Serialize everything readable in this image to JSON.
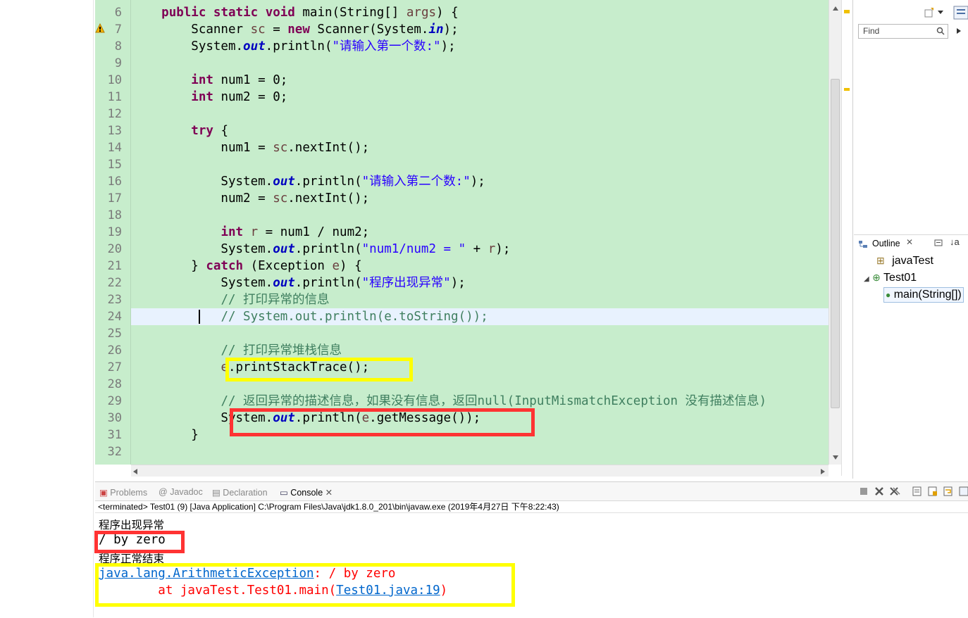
{
  "editor": {
    "lines": [
      {
        "num": "6",
        "segments": [
          {
            "t": "    ",
            "c": ""
          },
          {
            "t": "public",
            "c": "kw"
          },
          {
            "t": " ",
            "c": ""
          },
          {
            "t": "static",
            "c": "kw"
          },
          {
            "t": " ",
            "c": ""
          },
          {
            "t": "void",
            "c": "kw"
          },
          {
            "t": " main(String[] ",
            "c": ""
          },
          {
            "t": "args",
            "c": "var"
          },
          {
            "t": ") {",
            "c": ""
          }
        ]
      },
      {
        "num": "7",
        "segments": [
          {
            "t": "        Scanner ",
            "c": ""
          },
          {
            "t": "sc",
            "c": "var"
          },
          {
            "t": " = ",
            "c": ""
          },
          {
            "t": "new",
            "c": "kw"
          },
          {
            "t": " Scanner(System.",
            "c": ""
          },
          {
            "t": "in",
            "c": "fld"
          },
          {
            "t": ");",
            "c": ""
          }
        ]
      },
      {
        "num": "8",
        "segments": [
          {
            "t": "        System.",
            "c": ""
          },
          {
            "t": "out",
            "c": "fld"
          },
          {
            "t": ".println(",
            "c": ""
          },
          {
            "t": "\"请输入第一个数:\"",
            "c": "str"
          },
          {
            "t": ");",
            "c": ""
          }
        ]
      },
      {
        "num": "9",
        "segments": []
      },
      {
        "num": "10",
        "segments": [
          {
            "t": "        ",
            "c": ""
          },
          {
            "t": "int",
            "c": "kw"
          },
          {
            "t": " num1 = 0;",
            "c": ""
          }
        ]
      },
      {
        "num": "11",
        "segments": [
          {
            "t": "        ",
            "c": ""
          },
          {
            "t": "int",
            "c": "kw"
          },
          {
            "t": " num2 = 0;",
            "c": ""
          }
        ]
      },
      {
        "num": "12",
        "segments": []
      },
      {
        "num": "13",
        "segments": [
          {
            "t": "        ",
            "c": ""
          },
          {
            "t": "try",
            "c": "kw"
          },
          {
            "t": " {",
            "c": ""
          }
        ]
      },
      {
        "num": "14",
        "segments": [
          {
            "t": "            num1 = ",
            "c": ""
          },
          {
            "t": "sc",
            "c": "var"
          },
          {
            "t": ".nextInt();",
            "c": ""
          }
        ]
      },
      {
        "num": "15",
        "segments": []
      },
      {
        "num": "16",
        "segments": [
          {
            "t": "            System.",
            "c": ""
          },
          {
            "t": "out",
            "c": "fld"
          },
          {
            "t": ".println(",
            "c": ""
          },
          {
            "t": "\"请输入第二个数:\"",
            "c": "str"
          },
          {
            "t": ");",
            "c": ""
          }
        ]
      },
      {
        "num": "17",
        "segments": [
          {
            "t": "            num2 = ",
            "c": ""
          },
          {
            "t": "sc",
            "c": "var"
          },
          {
            "t": ".nextInt();",
            "c": ""
          }
        ]
      },
      {
        "num": "18",
        "segments": []
      },
      {
        "num": "19",
        "segments": [
          {
            "t": "            ",
            "c": ""
          },
          {
            "t": "int",
            "c": "kw"
          },
          {
            "t": " ",
            "c": ""
          },
          {
            "t": "r",
            "c": "var"
          },
          {
            "t": " = num1 / num2;",
            "c": ""
          }
        ]
      },
      {
        "num": "20",
        "segments": [
          {
            "t": "            System.",
            "c": ""
          },
          {
            "t": "out",
            "c": "fld"
          },
          {
            "t": ".println(",
            "c": ""
          },
          {
            "t": "\"num1/num2 = \"",
            "c": "str"
          },
          {
            "t": " + ",
            "c": ""
          },
          {
            "t": "r",
            "c": "var"
          },
          {
            "t": ");",
            "c": ""
          }
        ]
      },
      {
        "num": "21",
        "segments": [
          {
            "t": "        } ",
            "c": ""
          },
          {
            "t": "catch",
            "c": "kw"
          },
          {
            "t": " (Exception ",
            "c": ""
          },
          {
            "t": "e",
            "c": "var"
          },
          {
            "t": ") {",
            "c": ""
          }
        ]
      },
      {
        "num": "22",
        "segments": [
          {
            "t": "            System.",
            "c": ""
          },
          {
            "t": "out",
            "c": "fld"
          },
          {
            "t": ".println(",
            "c": ""
          },
          {
            "t": "\"程序出现异常\"",
            "c": "str"
          },
          {
            "t": ");",
            "c": ""
          }
        ]
      },
      {
        "num": "23",
        "segments": [
          {
            "t": "            ",
            "c": ""
          },
          {
            "t": "// 打印异常的信息",
            "c": "cmt"
          }
        ]
      },
      {
        "num": "24",
        "segments": [
          {
            "t": "            ",
            "c": ""
          },
          {
            "t": "// System.out.println(e.toString());",
            "c": "cmt"
          }
        ]
      },
      {
        "num": "25",
        "segments": []
      },
      {
        "num": "26",
        "segments": [
          {
            "t": "            ",
            "c": ""
          },
          {
            "t": "// 打印异常堆栈信息",
            "c": "cmt"
          }
        ]
      },
      {
        "num": "27",
        "segments": [
          {
            "t": "            ",
            "c": ""
          },
          {
            "t": "e",
            "c": "var"
          },
          {
            "t": ".printStackTrace();",
            "c": ""
          }
        ]
      },
      {
        "num": "28",
        "segments": []
      },
      {
        "num": "29",
        "segments": [
          {
            "t": "            ",
            "c": ""
          },
          {
            "t": "// 返回异常的描述信息，如果没有信息，返回null(InputMismatchException 没有描述信息)",
            "c": "cmt"
          }
        ]
      },
      {
        "num": "30",
        "segments": [
          {
            "t": "            System.",
            "c": ""
          },
          {
            "t": "out",
            "c": "fld"
          },
          {
            "t": ".println(",
            "c": ""
          },
          {
            "t": "e",
            "c": "var"
          },
          {
            "t": ".getMessage());",
            "c": ""
          }
        ]
      },
      {
        "num": "31",
        "segments": [
          {
            "t": "        }",
            "c": ""
          }
        ]
      },
      {
        "num": "32",
        "segments": []
      }
    ]
  },
  "right_panel": {
    "find_placeholder": "Find",
    "outline_tab": "Outline",
    "tree": [
      "javaTest",
      "Test01",
      "main(String[])"
    ]
  },
  "console": {
    "tabs": [
      "Problems",
      "Javadoc",
      "Declaration",
      "Console"
    ],
    "active_tab": "Console",
    "status": "<terminated> Test01 (9) [Java Application] C:\\Program Files\\Java\\jdk1.8.0_201\\bin\\javaw.exe (2019年4月27日 下午8:22:43)",
    "output": {
      "line1": "程序出现异常",
      "line2": "/ by zero",
      "line3": "程序正常结束",
      "exception_class": "java.lang.ArithmeticException",
      "exception_msg": ": / by zero",
      "at_prefix": "        at javaTest.Test01.main(",
      "at_link": "Test01.java:19",
      "at_suffix": ")"
    }
  },
  "colors": {
    "editor_bg": "#c7edcc",
    "highlight_yellow": "#ffff00",
    "highlight_red": "#ff3333",
    "keyword": "#7f0055",
    "string": "#2a00ff",
    "comment": "#3f7f5f"
  }
}
